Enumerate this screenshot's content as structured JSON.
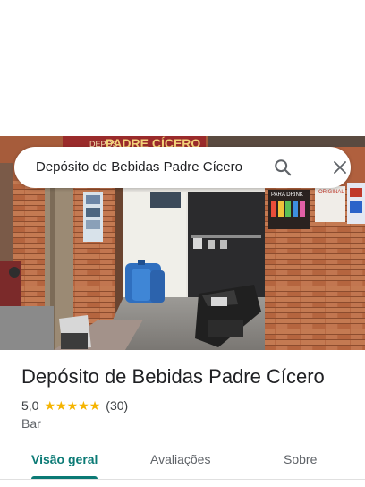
{
  "search": {
    "query": "Depósito de Bebidas Padre Cícero"
  },
  "photo": {
    "sign_text": "PADRE CÍCERO",
    "sign_text_top": "DEPÓS",
    "poster_text": "PARA DRINK",
    "poster_text_right": "ORIGINAL"
  },
  "place": {
    "name": "Depósito de Bebidas Padre Cícero",
    "rating": "5,0",
    "stars": 5,
    "reviews_count": "(30)",
    "category": "Bar"
  },
  "tabs": [
    {
      "label": "Visão geral",
      "active": true
    },
    {
      "label": "Avaliações",
      "active": false
    },
    {
      "label": "Sobre",
      "active": false
    }
  ],
  "colors": {
    "accent": "#0b7a75",
    "star": "#f5b400"
  }
}
